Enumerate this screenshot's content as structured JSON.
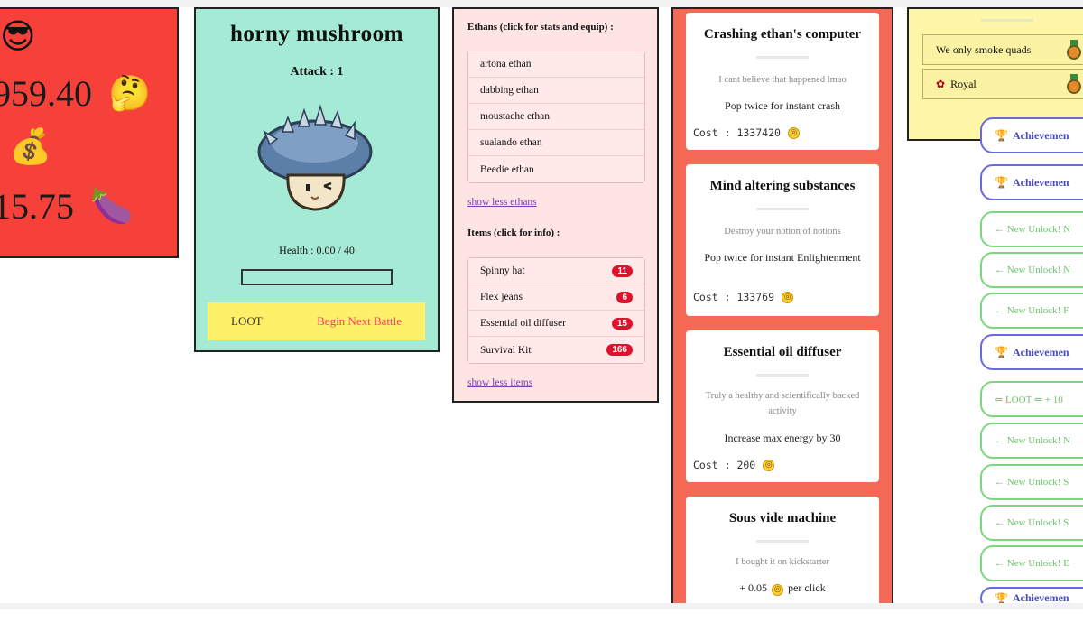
{
  "stats": {
    "face_emoji": "😎",
    "coins_value": "959.40",
    "thinking_emoji": "🤔",
    "moneybag_emoji": "💰",
    "secondary_value": "15.75",
    "eggplant_emoji": "🍆"
  },
  "battle": {
    "enemy_name": "horny mushroom",
    "attack_label": "Attack : 1",
    "health_label": "Health : 0.00 / 40",
    "health_fraction": 0,
    "loot_label": "LOOT",
    "next_battle_label": "Begin Next Battle"
  },
  "inventory": {
    "ethans_header": "Ethans (click for stats and equip) :",
    "ethans": [
      {
        "label": "artona ethan"
      },
      {
        "label": "dabbing ethan"
      },
      {
        "label": "moustache ethan"
      },
      {
        "label": "sualando ethan"
      },
      {
        "label": "Beedie ethan"
      }
    ],
    "show_less_ethans": "show less ethans",
    "items_header": "Items (click for info) :",
    "items": [
      {
        "label": "Spinny hat",
        "count": "11"
      },
      {
        "label": "Flex jeans",
        "count": "6"
      },
      {
        "label": "Essential oil diffuser",
        "count": "15"
      },
      {
        "label": "Survival Kit",
        "count": "166"
      }
    ],
    "show_less_items": "show less items"
  },
  "shop": {
    "cards": [
      {
        "title": "Crashing ethan's computer",
        "desc": "I cant believe that happened lmao",
        "effect": "Pop twice for instant crash",
        "cost": "Cost : 1337420"
      },
      {
        "title": "Mind altering substances",
        "desc": "Destroy your notion of notions",
        "effect": "Pop twice for instant Enlightenment",
        "cost": "Cost : 133769"
      },
      {
        "title": "Essential oil diffuser",
        "desc": "Truly a healthy and scientifically backed activity",
        "effect": "Increase max energy by 30",
        "cost": "Cost : 200"
      },
      {
        "title": "Sous vide machine",
        "desc": "I bought it on kickstarter",
        "effect_prefix": "+ 0.05",
        "effect_suffix": "per click"
      }
    ]
  },
  "achievements": {
    "items": [
      {
        "label": "We only smoke quads"
      },
      {
        "label": "Royal"
      }
    ]
  },
  "notifications": [
    {
      "text": "Achievemen",
      "kind": "achievement"
    },
    {
      "text": "Achievemen",
      "kind": "achievement"
    },
    {
      "text": "← New Unlock! N",
      "kind": "unlock"
    },
    {
      "text": "← New Unlock! N",
      "kind": "unlock"
    },
    {
      "text": "← New Unlock! F",
      "kind": "unlock"
    },
    {
      "text": "Achievemen",
      "kind": "achievement"
    },
    {
      "text": "⇐ LOOT ⇐ + 10",
      "kind": "unlock"
    },
    {
      "text": "← New Unlock! N",
      "kind": "unlock"
    },
    {
      "text": "← New Unlock! S",
      "kind": "unlock"
    },
    {
      "text": "← New Unlock! S",
      "kind": "unlock"
    },
    {
      "text": "← New Unlock! E",
      "kind": "unlock"
    },
    {
      "text": "Achievemen",
      "kind": "achievement"
    }
  ],
  "colors": {
    "stats_bg": "#f5413a",
    "battle_bg": "#a5ead4",
    "inventory_bg": "#ffe4e4",
    "shop_bg": "#f46a56",
    "achievements_bg": "#fff7a8",
    "loot_bar": "#fff06a",
    "badge": "#e0122b"
  }
}
